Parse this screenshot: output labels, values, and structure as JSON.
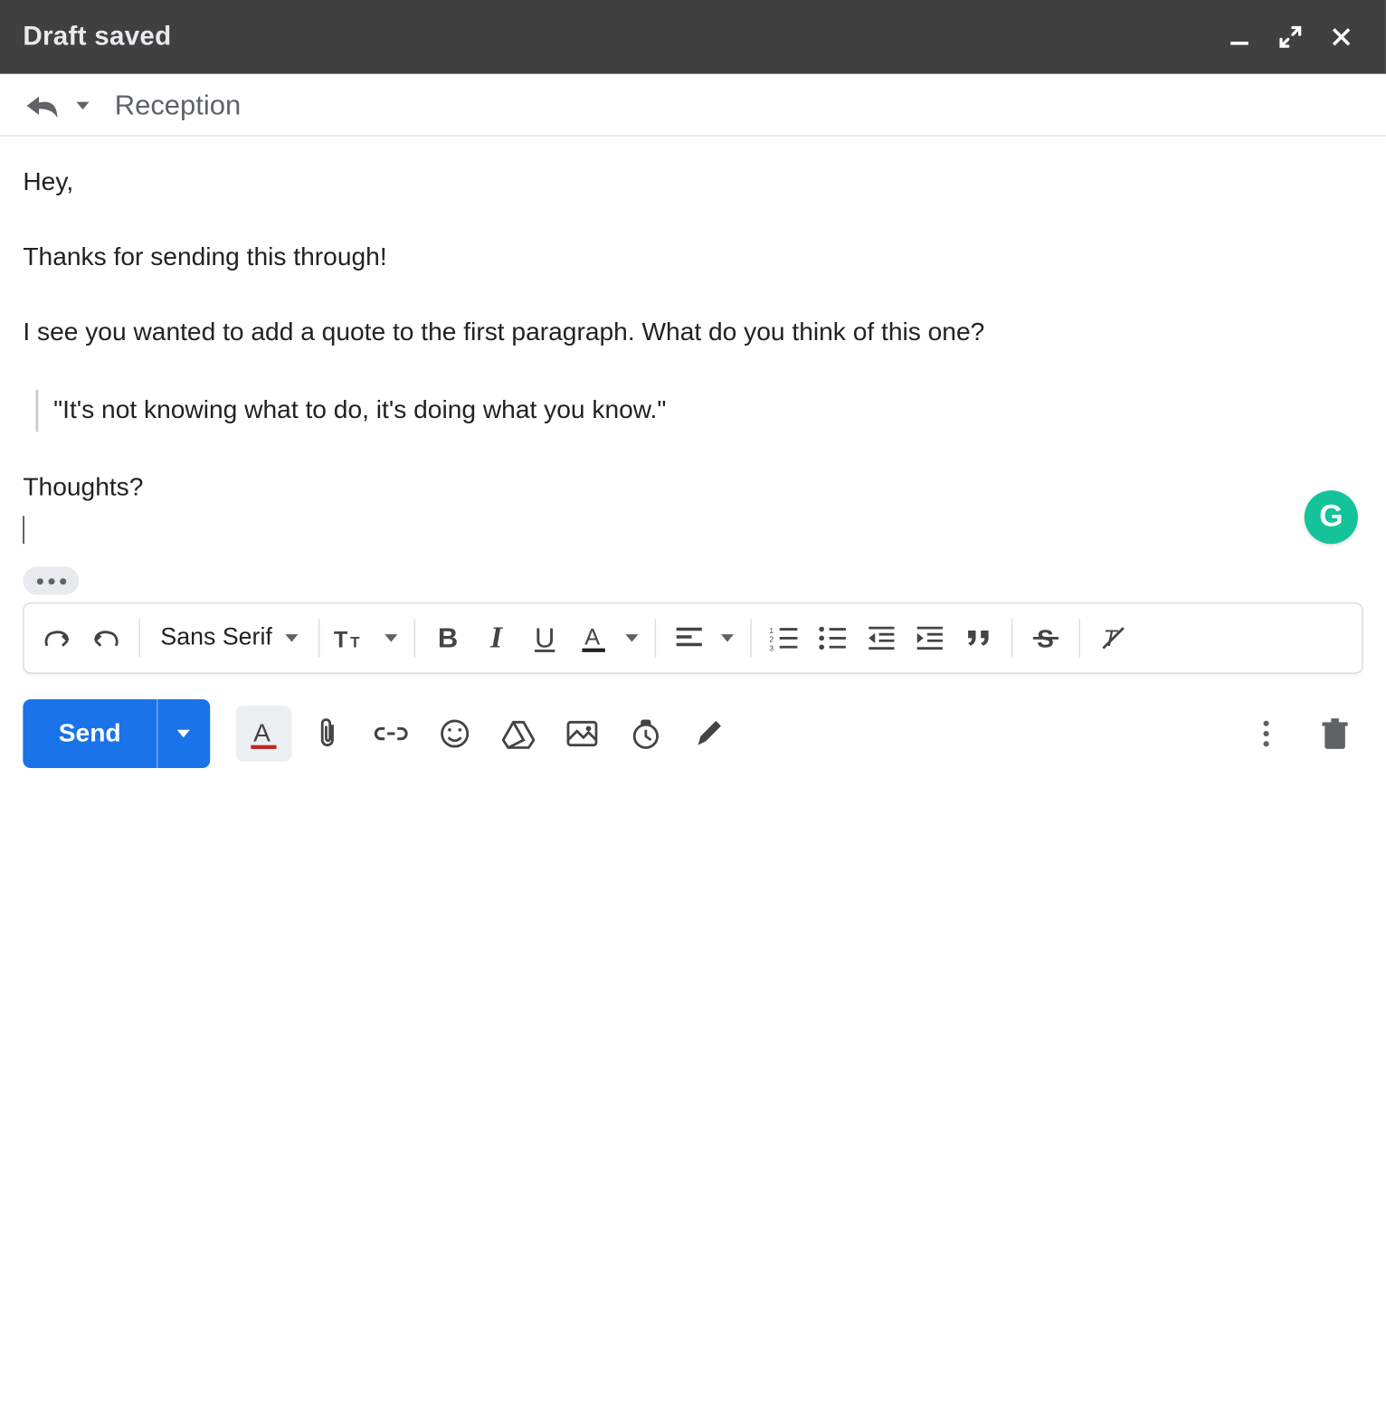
{
  "header": {
    "title": "Draft saved"
  },
  "subject": "Reception",
  "body": {
    "p1": "Hey,",
    "p2": "Thanks for sending this through!",
    "p3": "I see you wanted to add a quote to the first paragraph. What do you think of this one?",
    "quote": "\"It's not knowing what to do, it's doing what you know.\"",
    "p4": "Thoughts?"
  },
  "grammarly": "G",
  "toolbar": {
    "font": "Sans Serif"
  },
  "actions": {
    "send": "Send"
  }
}
